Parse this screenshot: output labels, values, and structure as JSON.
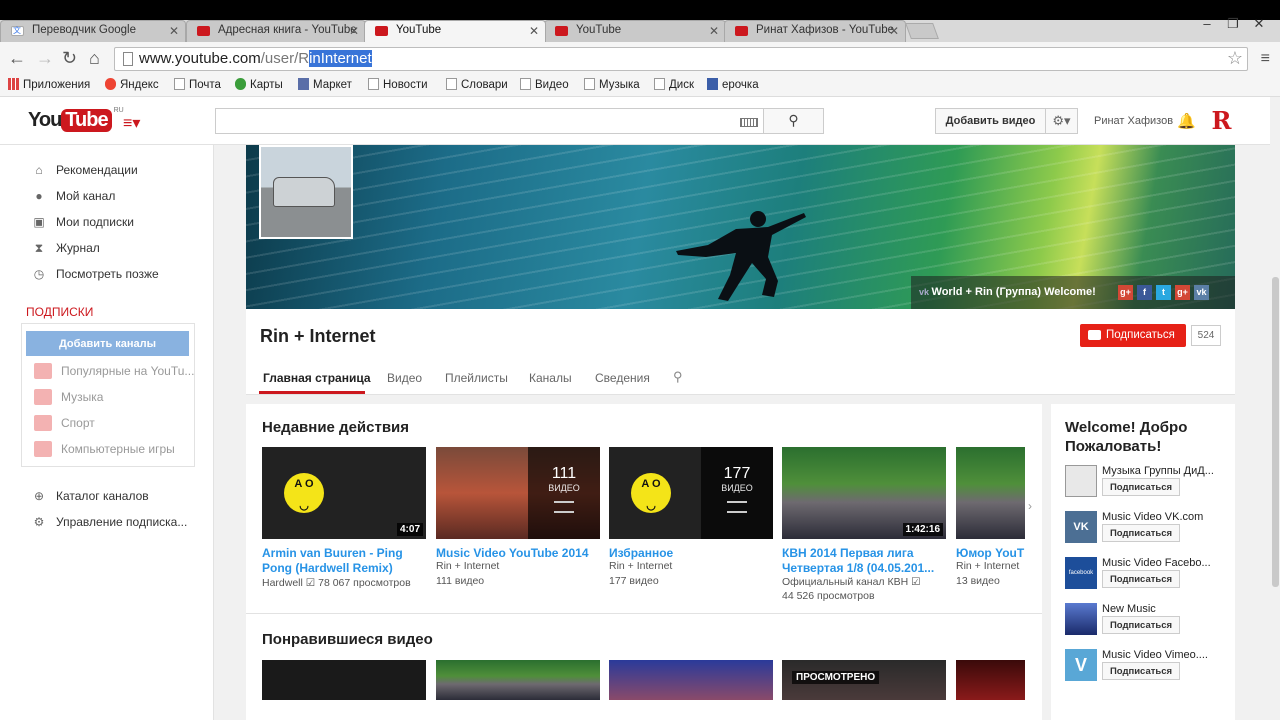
{
  "browser": {
    "tabs": [
      {
        "label": "Переводчик Google"
      },
      {
        "label": "Адресная книга - YouTube"
      },
      {
        "label": "YouTube"
      },
      {
        "label": "YouTube"
      },
      {
        "label": "Ринат Хафизов - YouTube"
      }
    ],
    "url_host": "www.youtube.com",
    "url_path": "/user/",
    "url_r": "R",
    "url_selected": "inInternet",
    "bookmarks": [
      "Приложения",
      "Яндекс",
      "Почта",
      "Карты",
      "Маркет",
      "Новости",
      "Словари",
      "Видео",
      "Музыка",
      "Диск",
      "ерочка"
    ]
  },
  "header": {
    "logo_you": "You",
    "logo_tube": "Tube",
    "logo_region": "RU",
    "add_video": "Добавить видео",
    "user_name": "Ринат Хафизов",
    "avatar_letter": "R"
  },
  "sidebar": {
    "items": [
      {
        "label": "Рекомендации",
        "icon": "home-icon"
      },
      {
        "label": "Мой канал",
        "icon": "user-icon"
      },
      {
        "label": "Мои подписки",
        "icon": "subscriptions-icon"
      },
      {
        "label": "Журнал",
        "icon": "history-icon"
      },
      {
        "label": "Посмотреть позже",
        "icon": "clock-icon"
      }
    ],
    "subs_heading": "подписки",
    "add_channels": "Добавить каналы",
    "subs": [
      "Популярные на YouTu...",
      "Музыка",
      "Спорт",
      "Компьютерные игры"
    ],
    "bottom": [
      "Каталог каналов",
      "Управление подписка..."
    ]
  },
  "channel": {
    "banner_text": "World + Rin (Группа) Welcome!",
    "title": "Rin + Internet",
    "subscribe": "Подписаться",
    "sub_count": "524",
    "tabs": [
      "Главная страница",
      "Видео",
      "Плейлисты",
      "Каналы",
      "Сведения"
    ]
  },
  "feed": {
    "recent_heading": "Недавние действия",
    "liked_heading": "Понравившиеся видео",
    "videos": [
      {
        "title": "Armin van Buuren - Ping Pong (Hardwell Remix)",
        "channel": "Hardwell",
        "views": "78 067 просмотров",
        "duration": "4:07"
      },
      {
        "title": "Music Video YouTube 2014",
        "channel": "Rin + Internet",
        "views": "111 видео",
        "count": "111",
        "count_label": "ВИДЕО"
      },
      {
        "title": "Избранное",
        "channel": "Rin + Internet",
        "views": "177 видео",
        "count": "177",
        "count_label": "ВИДЕО"
      },
      {
        "title": "КВН 2014 Первая лига Четвертая 1/8 (04.05.201...",
        "channel": "Официальный канал КВН",
        "views": "44 526 просмотров",
        "duration": "1:42:16"
      },
      {
        "title": "Юмор YouT",
        "channel": "Rin + Internet",
        "views": "13 видео"
      }
    ],
    "watched_label": "ПРОСМОТРЕНО"
  },
  "right": {
    "welcome": "Welcome! Добро Пожаловать!",
    "subscribe_label": "Подписаться",
    "channels": [
      {
        "name": "Музыка Группы ДиД...",
        "color": "#e8e8e8"
      },
      {
        "name": "Music Video VK.com",
        "color": "#4c6f94"
      },
      {
        "name": "Music Video Facebo...",
        "color": "#1d4e9a"
      },
      {
        "name": "New Music",
        "color": "#234a8a"
      },
      {
        "name": "Music Video Vimeo....",
        "color": "#59a7d6"
      }
    ]
  }
}
